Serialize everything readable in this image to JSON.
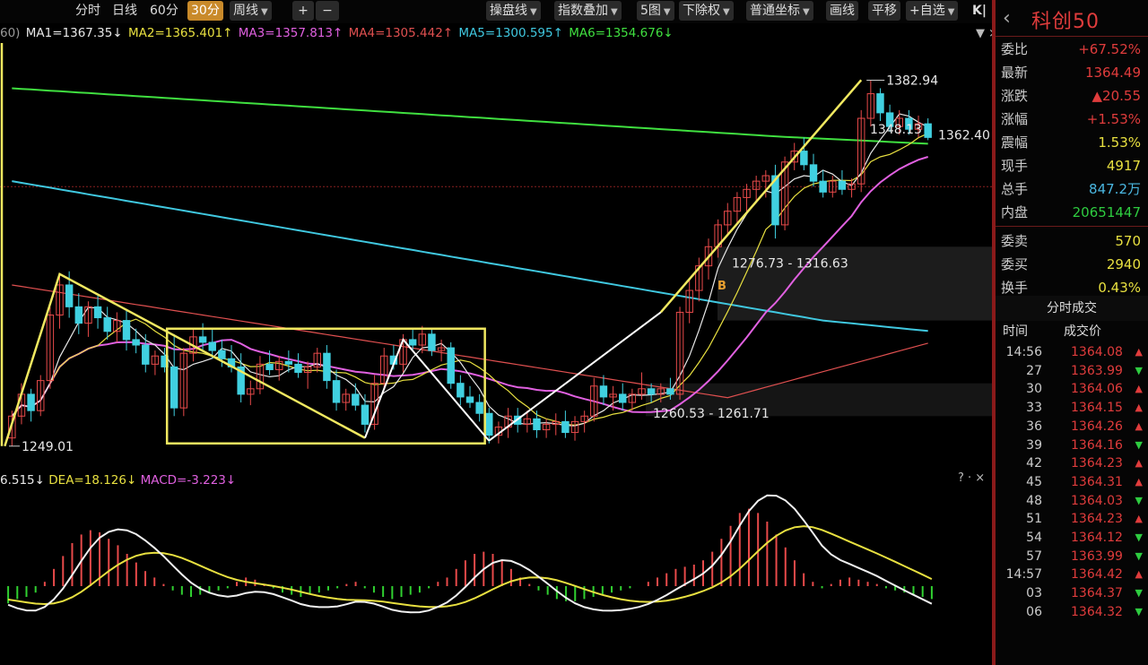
{
  "toolbar": {
    "period_buttons": [
      "分时",
      "日线",
      "60分",
      "30分",
      "周线"
    ],
    "active_period": "30分",
    "zoom_in": "+",
    "zoom_out": "−",
    "right_buttons": [
      "操盘线",
      "指数叠加",
      "5图",
      "下除权",
      "普通坐标",
      "画线",
      "平移",
      "+自选"
    ],
    "collapse": "K|"
  },
  "ma_line": {
    "prefix": "60)",
    "items": [
      {
        "text": "MA1=1367.35↓",
        "color": "#e8e8e8"
      },
      {
        "text": "MA2=1365.401↑",
        "color": "#e8e040"
      },
      {
        "text": "MA3=1357.813↑",
        "color": "#e060e0"
      },
      {
        "text": "MA4=1305.442↑",
        "color": "#e05050"
      },
      {
        "text": "MA5=1300.595↑",
        "color": "#40c8e0"
      },
      {
        "text": "MA6=1354.676↓",
        "color": "#40e040"
      }
    ]
  },
  "macd_head": {
    "items": [
      {
        "text": "6.515↓",
        "color": "#e8e8e8"
      },
      {
        "text": "DEA=18.126↓",
        "color": "#e8e040"
      },
      {
        "text": "MACD=-3.223↓",
        "color": "#e060e0"
      }
    ]
  },
  "chart_data": {
    "type": "candlestick",
    "title": "科创50",
    "period": "30分",
    "price_range": [
      1245,
      1390
    ],
    "annotations": {
      "high_label": "1382.94",
      "low_label": "1249.01",
      "last_label": "1362.40",
      "mid_label": "1348.13",
      "range_label_upper": "1276.73 - 1316.63",
      "range_label_lower": "1260.53 - 1261.71",
      "signal": "B"
    },
    "candles": [
      {
        "o": 1252,
        "h": 1262,
        "l": 1249,
        "c": 1260
      },
      {
        "o": 1260,
        "h": 1272,
        "l": 1257,
        "c": 1268
      },
      {
        "o": 1268,
        "h": 1270,
        "l": 1258,
        "c": 1262
      },
      {
        "o": 1262,
        "h": 1275,
        "l": 1260,
        "c": 1273
      },
      {
        "o": 1273,
        "h": 1300,
        "l": 1270,
        "c": 1297
      },
      {
        "o": 1297,
        "h": 1312,
        "l": 1292,
        "c": 1308
      },
      {
        "o": 1308,
        "h": 1313,
        "l": 1296,
        "c": 1300
      },
      {
        "o": 1300,
        "h": 1305,
        "l": 1290,
        "c": 1294
      },
      {
        "o": 1294,
        "h": 1302,
        "l": 1289,
        "c": 1300
      },
      {
        "o": 1300,
        "h": 1304,
        "l": 1292,
        "c": 1296
      },
      {
        "o": 1296,
        "h": 1300,
        "l": 1288,
        "c": 1291
      },
      {
        "o": 1291,
        "h": 1298,
        "l": 1287,
        "c": 1295
      },
      {
        "o": 1295,
        "h": 1299,
        "l": 1284,
        "c": 1288
      },
      {
        "o": 1288,
        "h": 1292,
        "l": 1283,
        "c": 1286
      },
      {
        "o": 1286,
        "h": 1290,
        "l": 1276,
        "c": 1279
      },
      {
        "o": 1279,
        "h": 1284,
        "l": 1275,
        "c": 1282
      },
      {
        "o": 1282,
        "h": 1285,
        "l": 1276,
        "c": 1278
      },
      {
        "o": 1278,
        "h": 1290,
        "l": 1260,
        "c": 1263
      },
      {
        "o": 1263,
        "h": 1285,
        "l": 1260,
        "c": 1283
      },
      {
        "o": 1283,
        "h": 1292,
        "l": 1280,
        "c": 1289
      },
      {
        "o": 1289,
        "h": 1294,
        "l": 1284,
        "c": 1287
      },
      {
        "o": 1287,
        "h": 1292,
        "l": 1281,
        "c": 1284
      },
      {
        "o": 1284,
        "h": 1288,
        "l": 1278,
        "c": 1281
      },
      {
        "o": 1281,
        "h": 1286,
        "l": 1276,
        "c": 1278
      },
      {
        "o": 1278,
        "h": 1283,
        "l": 1265,
        "c": 1268
      },
      {
        "o": 1268,
        "h": 1273,
        "l": 1264,
        "c": 1270
      },
      {
        "o": 1270,
        "h": 1282,
        "l": 1268,
        "c": 1279
      },
      {
        "o": 1279,
        "h": 1284,
        "l": 1275,
        "c": 1277
      },
      {
        "o": 1277,
        "h": 1282,
        "l": 1273,
        "c": 1280
      },
      {
        "o": 1280,
        "h": 1284,
        "l": 1276,
        "c": 1279
      },
      {
        "o": 1279,
        "h": 1283,
        "l": 1274,
        "c": 1276
      },
      {
        "o": 1276,
        "h": 1280,
        "l": 1270,
        "c": 1278
      },
      {
        "o": 1278,
        "h": 1285,
        "l": 1276,
        "c": 1283
      },
      {
        "o": 1283,
        "h": 1286,
        "l": 1270,
        "c": 1273
      },
      {
        "o": 1273,
        "h": 1277,
        "l": 1262,
        "c": 1265
      },
      {
        "o": 1265,
        "h": 1270,
        "l": 1262,
        "c": 1268
      },
      {
        "o": 1268,
        "h": 1272,
        "l": 1262,
        "c": 1264
      },
      {
        "o": 1264,
        "h": 1268,
        "l": 1254,
        "c": 1257
      },
      {
        "o": 1257,
        "h": 1275,
        "l": 1255,
        "c": 1272
      },
      {
        "o": 1272,
        "h": 1285,
        "l": 1270,
        "c": 1282
      },
      {
        "o": 1282,
        "h": 1286,
        "l": 1277,
        "c": 1279
      },
      {
        "o": 1279,
        "h": 1290,
        "l": 1276,
        "c": 1288
      },
      {
        "o": 1288,
        "h": 1292,
        "l": 1284,
        "c": 1286
      },
      {
        "o": 1286,
        "h": 1293,
        "l": 1283,
        "c": 1290
      },
      {
        "o": 1290,
        "h": 1292,
        "l": 1282,
        "c": 1284
      },
      {
        "o": 1284,
        "h": 1288,
        "l": 1280,
        "c": 1285
      },
      {
        "o": 1285,
        "h": 1287,
        "l": 1270,
        "c": 1272
      },
      {
        "o": 1272,
        "h": 1275,
        "l": 1264,
        "c": 1267
      },
      {
        "o": 1267,
        "h": 1271,
        "l": 1263,
        "c": 1265
      },
      {
        "o": 1265,
        "h": 1268,
        "l": 1258,
        "c": 1261
      },
      {
        "o": 1261,
        "h": 1263,
        "l": 1250,
        "c": 1253
      },
      {
        "o": 1253,
        "h": 1258,
        "l": 1250,
        "c": 1256
      },
      {
        "o": 1256,
        "h": 1263,
        "l": 1252,
        "c": 1260
      },
      {
        "o": 1260,
        "h": 1263,
        "l": 1254,
        "c": 1257
      },
      {
        "o": 1257,
        "h": 1262,
        "l": 1254,
        "c": 1259
      },
      {
        "o": 1259,
        "h": 1262,
        "l": 1252,
        "c": 1255
      },
      {
        "o": 1255,
        "h": 1259,
        "l": 1252,
        "c": 1257
      },
      {
        "o": 1257,
        "h": 1261,
        "l": 1253,
        "c": 1258
      },
      {
        "o": 1258,
        "h": 1262,
        "l": 1252,
        "c": 1254
      },
      {
        "o": 1254,
        "h": 1260,
        "l": 1251,
        "c": 1258
      },
      {
        "o": 1258,
        "h": 1262,
        "l": 1254,
        "c": 1260
      },
      {
        "o": 1260,
        "h": 1274,
        "l": 1258,
        "c": 1271
      },
      {
        "o": 1271,
        "h": 1275,
        "l": 1264,
        "c": 1267
      },
      {
        "o": 1267,
        "h": 1271,
        "l": 1262,
        "c": 1268
      },
      {
        "o": 1268,
        "h": 1272,
        "l": 1262,
        "c": 1265
      },
      {
        "o": 1265,
        "h": 1270,
        "l": 1262,
        "c": 1268
      },
      {
        "o": 1268,
        "h": 1276,
        "l": 1266,
        "c": 1270
      },
      {
        "o": 1270,
        "h": 1272,
        "l": 1265,
        "c": 1268
      },
      {
        "o": 1268,
        "h": 1272,
        "l": 1265,
        "c": 1270
      },
      {
        "o": 1270,
        "h": 1274,
        "l": 1266,
        "c": 1268
      },
      {
        "o": 1268,
        "h": 1300,
        "l": 1266,
        "c": 1298
      },
      {
        "o": 1298,
        "h": 1310,
        "l": 1294,
        "c": 1306
      },
      {
        "o": 1306,
        "h": 1318,
        "l": 1302,
        "c": 1315
      },
      {
        "o": 1315,
        "h": 1325,
        "l": 1310,
        "c": 1322
      },
      {
        "o": 1322,
        "h": 1332,
        "l": 1318,
        "c": 1330
      },
      {
        "o": 1330,
        "h": 1338,
        "l": 1326,
        "c": 1335
      },
      {
        "o": 1335,
        "h": 1342,
        "l": 1330,
        "c": 1340
      },
      {
        "o": 1340,
        "h": 1345,
        "l": 1334,
        "c": 1343
      },
      {
        "o": 1343,
        "h": 1348,
        "l": 1338,
        "c": 1346
      },
      {
        "o": 1346,
        "h": 1350,
        "l": 1340,
        "c": 1348
      },
      {
        "o": 1348,
        "h": 1352,
        "l": 1325,
        "c": 1330
      },
      {
        "o": 1330,
        "h": 1355,
        "l": 1328,
        "c": 1353
      },
      {
        "o": 1353,
        "h": 1360,
        "l": 1350,
        "c": 1357
      },
      {
        "o": 1357,
        "h": 1362,
        "l": 1350,
        "c": 1352
      },
      {
        "o": 1352,
        "h": 1356,
        "l": 1344,
        "c": 1346
      },
      {
        "o": 1346,
        "h": 1350,
        "l": 1340,
        "c": 1342
      },
      {
        "o": 1342,
        "h": 1348,
        "l": 1340,
        "c": 1346
      },
      {
        "o": 1346,
        "h": 1350,
        "l": 1341,
        "c": 1343
      },
      {
        "o": 1343,
        "h": 1347,
        "l": 1340,
        "c": 1345
      },
      {
        "o": 1345,
        "h": 1372,
        "l": 1342,
        "c": 1369
      },
      {
        "o": 1369,
        "h": 1383,
        "l": 1366,
        "c": 1378
      },
      {
        "o": 1378,
        "h": 1380,
        "l": 1368,
        "c": 1371
      },
      {
        "o": 1371,
        "h": 1374,
        "l": 1364,
        "c": 1366
      },
      {
        "o": 1366,
        "h": 1372,
        "l": 1363,
        "c": 1369
      },
      {
        "o": 1369,
        "h": 1372,
        "l": 1363,
        "c": 1365
      },
      {
        "o": 1365,
        "h": 1370,
        "l": 1362,
        "c": 1367
      },
      {
        "o": 1367,
        "h": 1369,
        "l": 1361,
        "c": 1362
      }
    ],
    "ma_colors": {
      "MA1": "#e8e8e8",
      "MA2": "#e8e040",
      "MA3": "#e060e0",
      "MA4": "#e05050",
      "MA5": "#40c8e0",
      "MA6": "#40e040"
    },
    "macd": {
      "hist": [
        -8,
        -6,
        -5,
        -3,
        2,
        8,
        14,
        20,
        24,
        26,
        25,
        22,
        19,
        15,
        11,
        7,
        4,
        1,
        -2,
        -4,
        -5,
        -4,
        -3,
        -2,
        -1,
        2,
        4,
        3,
        1,
        -1,
        -3,
        -4,
        -5,
        -4,
        -3,
        -2,
        -1,
        1,
        2,
        -1,
        -3,
        -5,
        -6,
        -5,
        -4,
        -3,
        -1,
        2,
        4,
        8,
        12,
        15,
        16,
        15,
        12,
        8,
        4,
        1,
        -2,
        -4,
        -6,
        -7,
        -7,
        -6,
        -5,
        -4,
        -3,
        -2,
        -1,
        0,
        2,
        4,
        6,
        8,
        9,
        10,
        12,
        16,
        22,
        28,
        34,
        36,
        34,
        30,
        24,
        18,
        12,
        6,
        2,
        -1,
        1,
        3,
        4,
        3,
        2,
        1,
        -1,
        -2,
        -3,
        -4,
        -5,
        -6
      ]
    }
  },
  "panel": {
    "title": "科创50",
    "rows": [
      {
        "label": "委比",
        "value": "+67.52%",
        "cls": "red"
      },
      {
        "label": "最新",
        "value": "1364.49",
        "cls": "red"
      },
      {
        "label": "涨跌",
        "value": "▲20.55",
        "cls": "red"
      },
      {
        "label": "涨幅",
        "value": "+1.53%",
        "cls": "red"
      },
      {
        "label": "震幅",
        "value": "1.53%",
        "cls": "yellow"
      },
      {
        "label": "现手",
        "value": "4917",
        "cls": "yellow"
      },
      {
        "label": "总手",
        "value": "847.2万",
        "cls": "cyan"
      },
      {
        "label": "内盘",
        "value": "20651447",
        "cls": "green"
      },
      {
        "label": "委卖",
        "value": "570",
        "cls": "yellow"
      },
      {
        "label": "委买",
        "value": "2940",
        "cls": "yellow"
      },
      {
        "label": "换手",
        "value": "0.43%",
        "cls": "yellow"
      }
    ],
    "ticks_title": "分时成交",
    "ticks_head": {
      "time": "时间",
      "price": "成交价"
    },
    "ticks": [
      {
        "t": "14:56",
        "p": "1364.08",
        "d": "up"
      },
      {
        "t": "27",
        "p": "1363.99",
        "d": "down"
      },
      {
        "t": "30",
        "p": "1364.06",
        "d": "up"
      },
      {
        "t": "33",
        "p": "1364.15",
        "d": "up"
      },
      {
        "t": "36",
        "p": "1364.26",
        "d": "up"
      },
      {
        "t": "39",
        "p": "1364.16",
        "d": "down"
      },
      {
        "t": "42",
        "p": "1364.23",
        "d": "up"
      },
      {
        "t": "45",
        "p": "1364.31",
        "d": "up"
      },
      {
        "t": "48",
        "p": "1364.03",
        "d": "down"
      },
      {
        "t": "51",
        "p": "1364.23",
        "d": "up"
      },
      {
        "t": "54",
        "p": "1364.12",
        "d": "down"
      },
      {
        "t": "57",
        "p": "1363.99",
        "d": "down"
      },
      {
        "t": "14:57",
        "p": "1364.42",
        "d": "up"
      },
      {
        "t": "03",
        "p": "1364.37",
        "d": "down"
      },
      {
        "t": "06",
        "p": "1364.32",
        "d": "down"
      }
    ]
  }
}
